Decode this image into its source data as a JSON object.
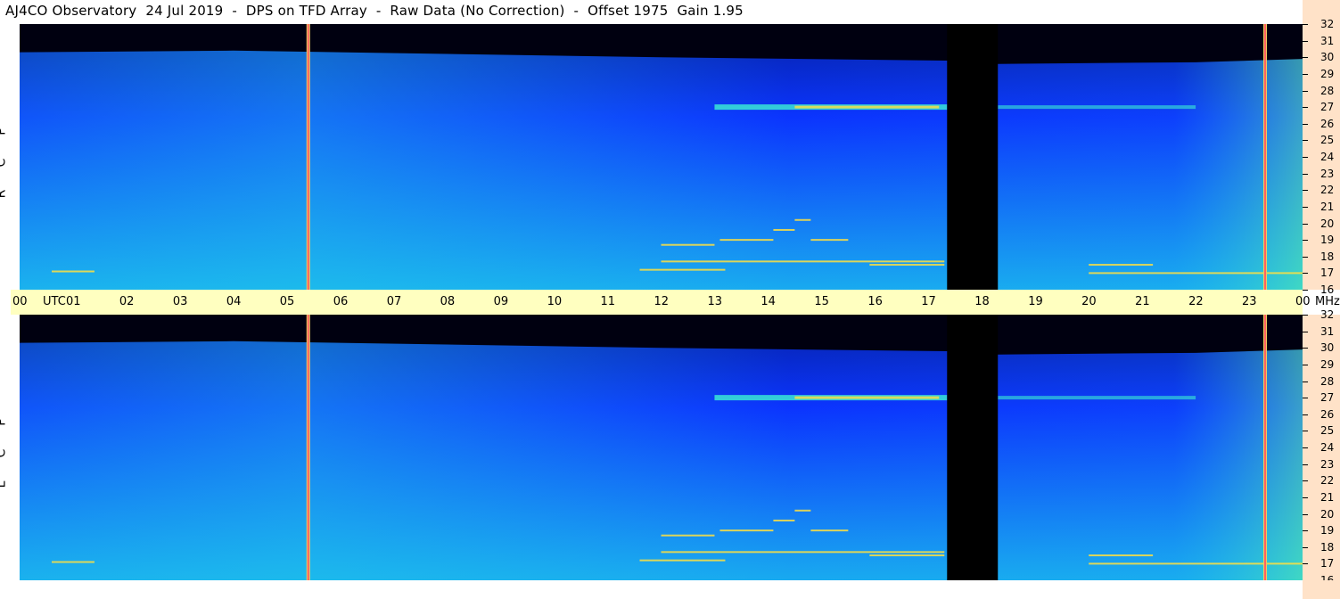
{
  "header": {
    "title": "AJ4CO Observatory  24 Jul 2019  -  DPS on TFD Array  -  Raw Data (No Correction)  -  Offset 1975  Gain 1.95"
  },
  "panels": {
    "rcp_label": [
      "R",
      "C",
      "P"
    ],
    "lcp_label": [
      "L",
      "C",
      "P"
    ]
  },
  "time_axis": {
    "ticks": [
      "00",
      "UTC",
      "01",
      "02",
      "03",
      "04",
      "05",
      "06",
      "07",
      "08",
      "09",
      "10",
      "11",
      "12",
      "13",
      "14",
      "15",
      "16",
      "17",
      "18",
      "19",
      "20",
      "21",
      "22",
      "23",
      "00",
      "MHz"
    ]
  },
  "freq_axis": {
    "ticks": [
      "32",
      "31",
      "30",
      "29",
      "28",
      "27",
      "26",
      "25",
      "24",
      "23",
      "22",
      "21",
      "20",
      "19",
      "18",
      "17",
      "16"
    ]
  },
  "colors": {
    "background_low": "#0a2cff",
    "background_high": "#22d0e8",
    "signal": "#ffe040",
    "gap": "#000000",
    "interference_line": "#ff6060",
    "time_axis_bg": "#ffffc0",
    "freq_axis_bg": "#ffe2c8"
  },
  "chart_data": {
    "type": "heatmap",
    "title": "AJ4CO Observatory  24 Jul 2019  -  DPS on TFD Array  -  Raw Data (No Correction)  -  Offset 1975  Gain 1.95",
    "xlabel": "UTC",
    "ylabel": "MHz",
    "x_range_hours": [
      0,
      24
    ],
    "y_range_mhz": [
      16,
      32
    ],
    "panels": [
      "RCP",
      "LCP"
    ],
    "data_gaps_utc_hours": [
      [
        17.35,
        18.3
      ]
    ],
    "vertical_interference_utc_hours": [
      5.4,
      23.3
    ],
    "bright_bands_mhz": [
      27,
      17
    ],
    "grid": false,
    "legend": "none"
  }
}
